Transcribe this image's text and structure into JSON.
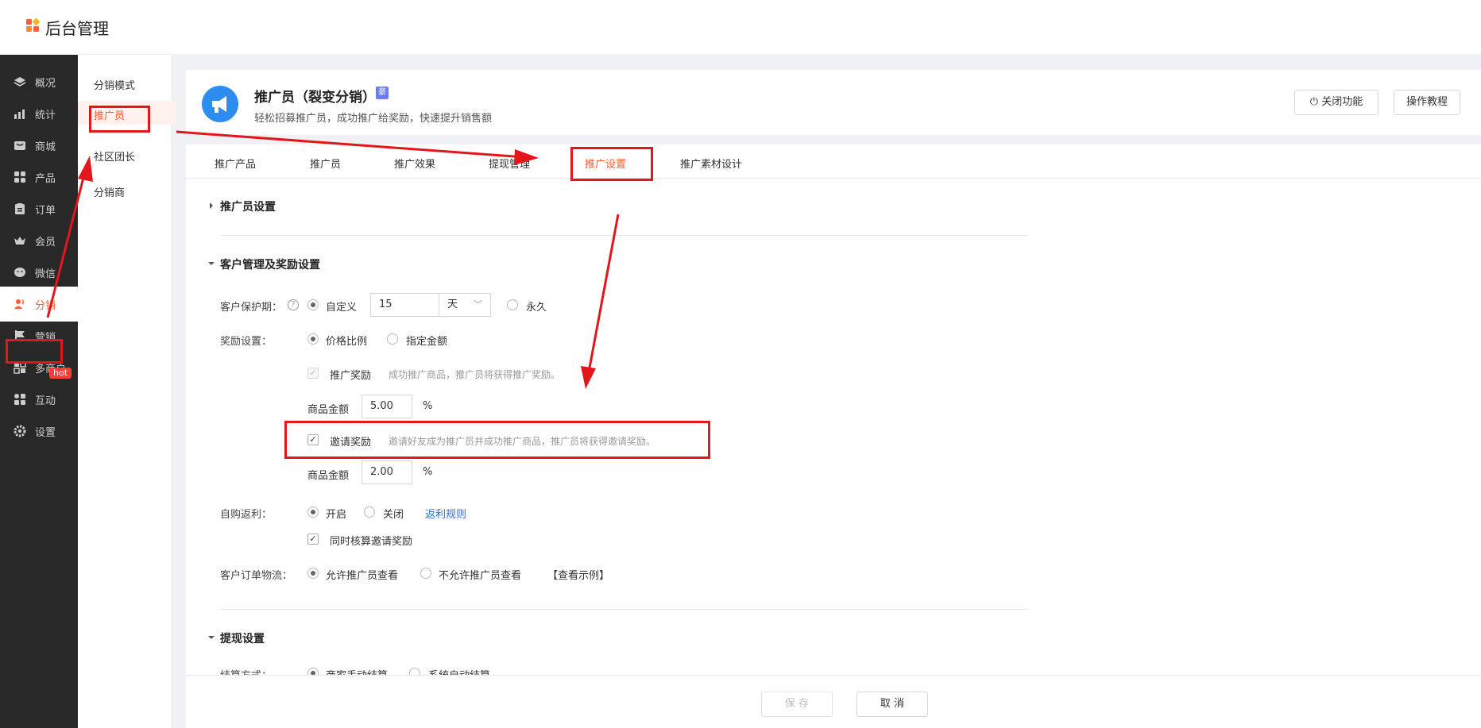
{
  "app": {
    "title": "后台管理"
  },
  "nav": {
    "items": [
      {
        "label": "概况",
        "icon": "layers-icon"
      },
      {
        "label": "统计",
        "icon": "chart-icon"
      },
      {
        "label": "商城",
        "icon": "shop-icon"
      },
      {
        "label": "产品",
        "icon": "grid-icon"
      },
      {
        "label": "订单",
        "icon": "clipboard-icon"
      },
      {
        "label": "会员",
        "icon": "crown-icon"
      },
      {
        "label": "微信",
        "icon": "wechat-icon"
      },
      {
        "label": "分销",
        "icon": "users-icon"
      },
      {
        "label": "营销",
        "icon": "flag-icon"
      },
      {
        "label": "多商户",
        "icon": "store-icon"
      },
      {
        "label": "互动",
        "icon": "apps-icon"
      },
      {
        "label": "设置",
        "icon": "gear-icon"
      }
    ],
    "hot_badge": "hot"
  },
  "subnav": {
    "items": [
      "分销模式",
      "推广员",
      "社区团长",
      "分销商"
    ]
  },
  "header": {
    "title": "推广员（裂变分销）",
    "badge": "豪",
    "subtitle": "轻松招募推广员，成功推广给奖励，快速提升销售额",
    "close_label": "关闭功能",
    "tutorial_label": "操作教程"
  },
  "tabs": [
    "推广产品",
    "推广员",
    "推广效果",
    "提现管理",
    "推广设置",
    "推广素材设计"
  ],
  "sections": {
    "promoter": "推广员设置",
    "customer": "客户管理及奖励设置",
    "withdraw": "提现设置"
  },
  "form": {
    "protect_label": "客户保护期：",
    "protect_custom": "自定义",
    "protect_value": "15",
    "protect_unit": "天",
    "protect_forever": "永久",
    "reward_label": "奖励设置：",
    "reward_ratio": "价格比例",
    "reward_fixed": "指定金额",
    "promote_reward": "推广奖励",
    "promote_hint": "成功推广商品，推广员将获得推广奖励。",
    "amount_label": "商品金额",
    "promote_amount": "5.00",
    "percent": "%",
    "invite_reward": "邀请奖励",
    "invite_hint": "邀请好友成为推广员并成功推广商品，推广员将获得邀请奖励。",
    "invite_amount": "2.00",
    "rebate_label": "自购返利：",
    "rebate_on": "开启",
    "rebate_off": "关闭",
    "rebate_rule": "返利规则",
    "sync_invite": "同时核算邀请奖励",
    "logistics_label": "客户订单物流：",
    "logistics_allow": "允许推广员查看",
    "logistics_deny": "不允许推广员查看",
    "logistics_example": "【查看示例】",
    "settle_label": "结算方式：",
    "settle_manual": "商家手动结算",
    "settle_auto": "系统自动结算"
  },
  "footer": {
    "save": "保 存",
    "cancel": "取 消"
  },
  "colors": {
    "accent": "#ff5d34",
    "annotation": "#e3161c",
    "sidebar": "#282828",
    "link": "#2d6fd6"
  }
}
